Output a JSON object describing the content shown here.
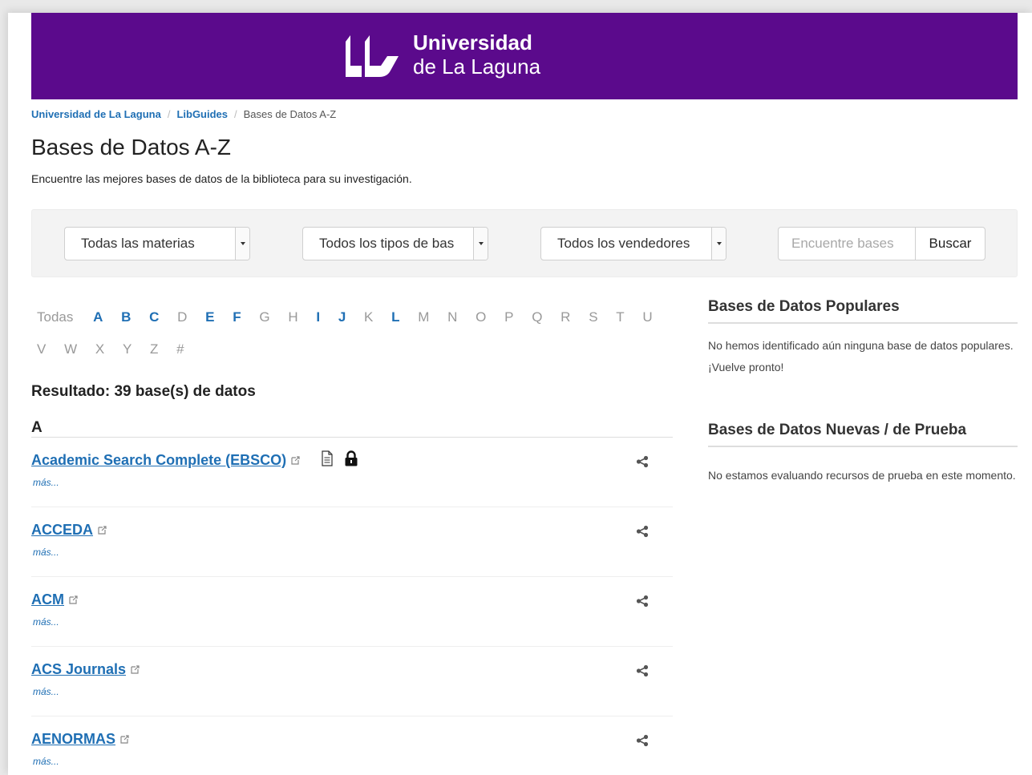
{
  "header": {
    "logo_line1": "Universidad",
    "logo_line2": "de La Laguna",
    "banner_color": "#5b0a8c"
  },
  "breadcrumb": {
    "items": [
      "Universidad de La Laguna",
      "LibGuides",
      "Bases de Datos A-Z"
    ]
  },
  "page": {
    "title": "Bases de Datos A-Z",
    "subtitle": "Encuentre las mejores bases de datos de la biblioteca para su investigación."
  },
  "filters": {
    "subjects": "Todas las materias",
    "types": "Todos los tipos de bas",
    "vendors": "Todos los vendedores",
    "search_placeholder": "Encuentre bases",
    "search_button": "Buscar"
  },
  "az": {
    "all_label": "Todas",
    "row1": [
      "A",
      "B",
      "C",
      "D",
      "E",
      "F",
      "G",
      "H",
      "I",
      "J",
      "K",
      "L",
      "M",
      "N",
      "O",
      "P",
      "Q",
      "R",
      "S",
      "T",
      "U"
    ],
    "row2": [
      "V",
      "W",
      "X",
      "Y",
      "Z",
      "#"
    ],
    "active": [
      "A",
      "B",
      "C",
      "E",
      "F",
      "I",
      "J",
      "L"
    ]
  },
  "results": {
    "count_label": "Resultado: 39 base(s) de datos",
    "group_letter": "A",
    "more_label": "más...",
    "items": [
      {
        "title": "Academic Search Complete (EBSCO)",
        "doc_icon": true,
        "lock_icon": true
      },
      {
        "title": "ACCEDA"
      },
      {
        "title": "ACM"
      },
      {
        "title": "ACS Journals"
      },
      {
        "title": "AENORMAS"
      }
    ]
  },
  "sidebar": {
    "popular_title": "Bases de Datos Populares",
    "popular_text": "No hemos identificado aún ninguna base de datos populares. ¡Vuelve pronto!",
    "new_title": "Bases de Datos Nuevas / de Prueba",
    "new_text": "No estamos evaluando recursos de prueba en este momento."
  },
  "colors": {
    "link": "#1f6fb4",
    "inactive_letter": "#999999"
  }
}
